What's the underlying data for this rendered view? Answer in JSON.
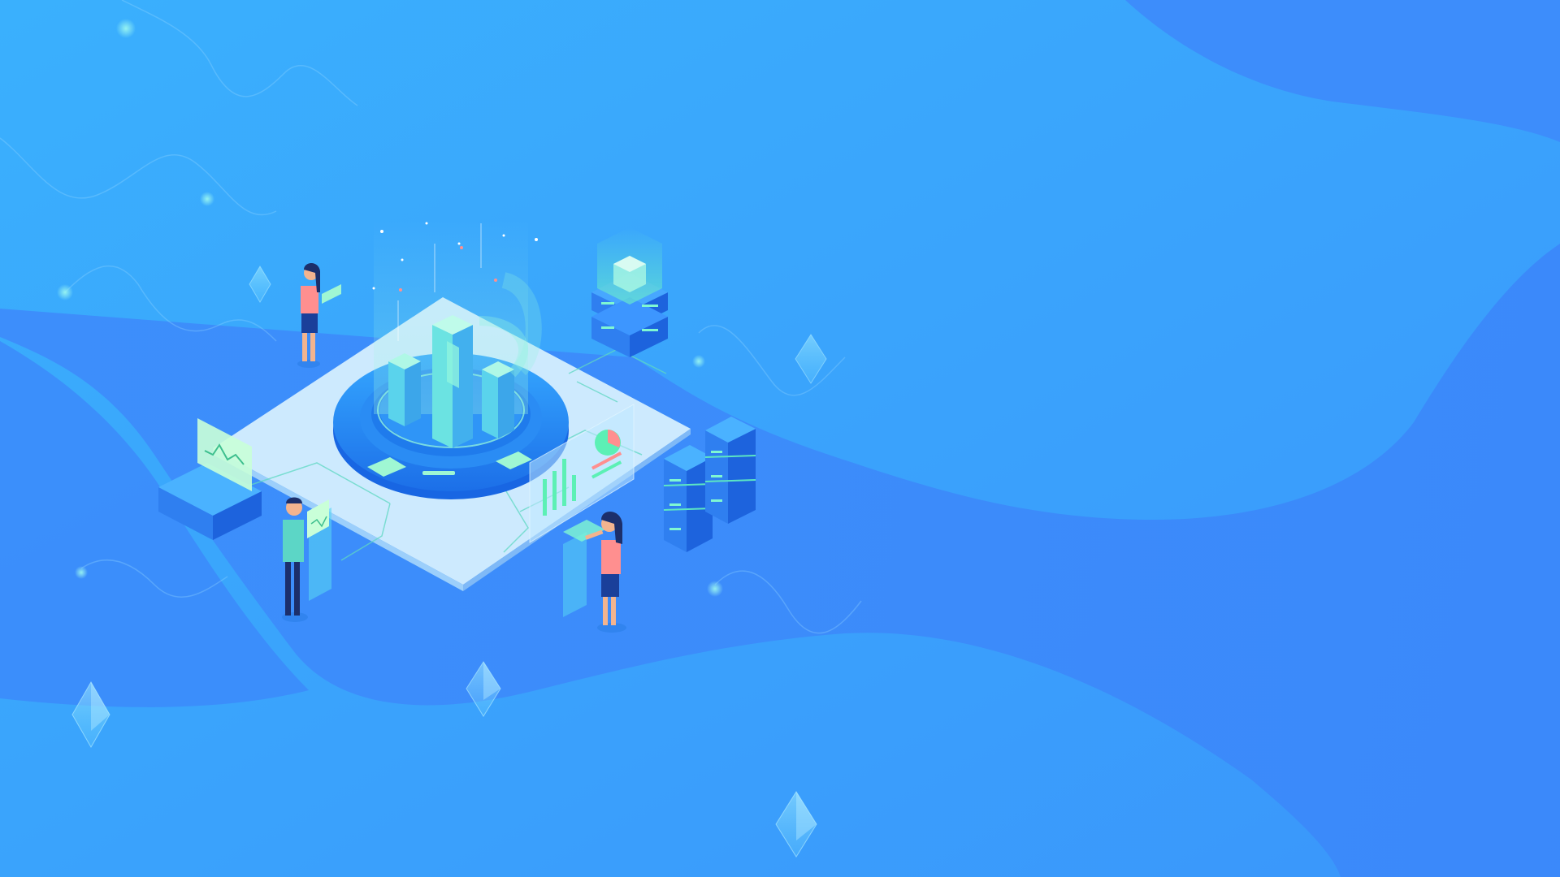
{
  "scene": {
    "colors": {
      "background": "#3aa4fb",
      "blob_dark": "#3d8bfb",
      "platform": "#cdeafe",
      "accent_green": "#5cf0b5",
      "server_blue": "#2f7ff0",
      "skin": "#f3b48f",
      "shirt_pink": "#ff8f8f"
    }
  }
}
